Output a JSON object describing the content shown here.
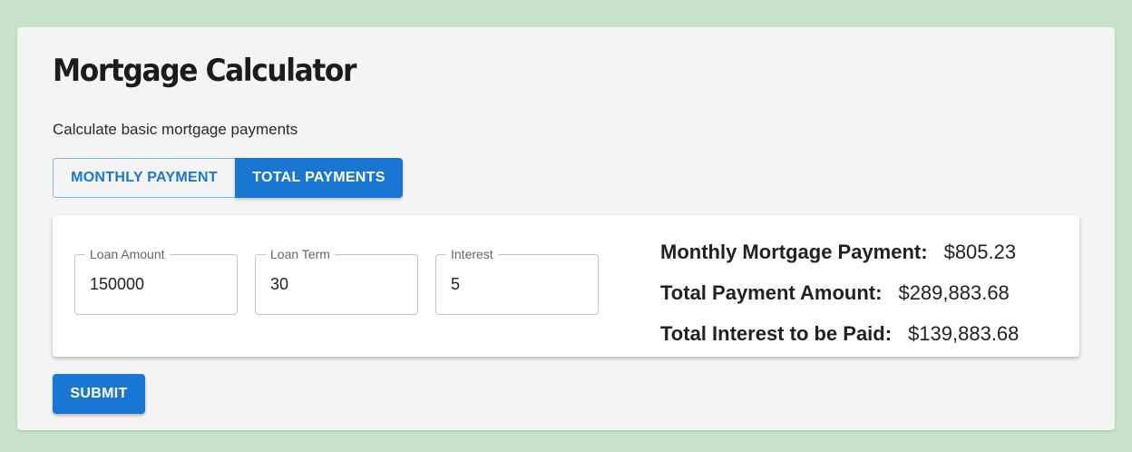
{
  "app": {
    "title": "Mortgage Calculator",
    "subtitle": "Calculate basic mortgage payments"
  },
  "tabs": [
    {
      "label": "MONTHLY PAYMENT",
      "active": false
    },
    {
      "label": "TOTAL PAYMENTS",
      "active": true
    }
  ],
  "form": {
    "loan_amount": {
      "label": "Loan Amount",
      "value": "150000"
    },
    "loan_term": {
      "label": "Loan Term",
      "value": "30"
    },
    "interest": {
      "label": "Interest",
      "value": "5"
    }
  },
  "results": [
    {
      "label": "Monthly Mortgage Payment:",
      "value": "$805.23"
    },
    {
      "label": "Total Payment Amount:",
      "value": "$289,883.68"
    },
    {
      "label": "Total Interest to be Paid:",
      "value": "$139,883.68"
    }
  ],
  "submit_label": "SUBMIT",
  "colors": {
    "accent": "#1976d2",
    "page_background": "#c8e2c9",
    "card_background": "#f4f4f4"
  }
}
